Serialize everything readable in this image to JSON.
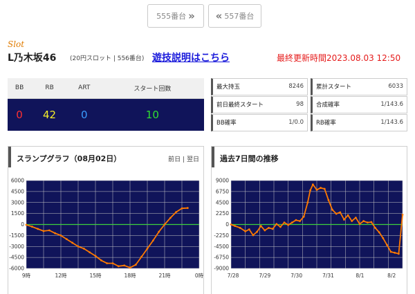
{
  "nav": {
    "prev_label": "555番台",
    "next_label": "557番台",
    "prev_icon": "double-chevron-right-icon",
    "next_icon": "double-chevron-left-icon"
  },
  "header": {
    "category": "Slot",
    "machine_name": "L乃木坂46",
    "machine_info": "(20円スロット | 556番台)",
    "guide_link": "遊技説明はこちら",
    "updated": "最終更新時間2023.08.03 12:50"
  },
  "counts": {
    "headers": [
      "BB",
      "RB",
      "ART",
      "スタート回数"
    ],
    "values": [
      "0",
      "42",
      "0",
      "10"
    ]
  },
  "stats": {
    "left": [
      {
        "label": "最大持玉",
        "value": "8246"
      },
      {
        "label": "前日最終スタート",
        "value": "98"
      },
      {
        "label": "BB確率",
        "value": "1/0.0"
      }
    ],
    "right": [
      {
        "label": "累計スタート",
        "value": "6033"
      },
      {
        "label": "合成確率",
        "value": "1/143.6"
      },
      {
        "label": "RB確率",
        "value": "1/143.6"
      }
    ]
  },
  "slump_panel": {
    "title": "スランプグラフ（08月02日）",
    "prev_link": "前日",
    "separator": "|",
    "next_link": "翌日"
  },
  "week_panel": {
    "title": "過去7日間の推移"
  },
  "colors": {
    "plot_bg": "#10145a",
    "grid": "#c8c8c8",
    "line": "#ff7a00",
    "zero_line": "#3cd23c",
    "accent_orange": "#e07b00",
    "update_red": "#e51b1b",
    "link_blue": "#1a1adb"
  },
  "chart_data": [
    {
      "type": "line",
      "title": "",
      "xlabel": "",
      "ylabel": "",
      "x_ticks": [
        "9時",
        "12時",
        "15時",
        "18時",
        "21時",
        "0時"
      ],
      "ylim": [
        -6000,
        6000
      ],
      "y_ticks": [
        "6000",
        "4500",
        "3000",
        "1500",
        "0",
        "-1500",
        "-3000",
        "-4500",
        "-6000"
      ],
      "x_range": [
        9,
        24
      ],
      "grid": true,
      "zero_line": true,
      "series": [
        {
          "x": [
            9.0,
            9.5,
            10.0,
            10.5,
            11.0,
            11.5,
            12.0,
            12.5,
            13.0,
            13.5,
            14.0,
            14.5,
            15.0,
            15.5,
            16.0,
            16.5,
            17.0,
            17.5,
            18.0,
            18.5,
            19.0,
            19.5,
            20.0,
            20.5,
            21.0,
            21.5,
            22.0,
            22.5,
            23.0
          ],
          "y": [
            -50,
            -300,
            -600,
            -900,
            -800,
            -1200,
            -1500,
            -2000,
            -2500,
            -3000,
            -3300,
            -3800,
            -4300,
            -4900,
            -5300,
            -5300,
            -5700,
            -5600,
            -5900,
            -5500,
            -4400,
            -3300,
            -2200,
            -1000,
            0,
            900,
            1700,
            2200,
            2250
          ]
        }
      ]
    },
    {
      "type": "line",
      "title": "",
      "xlabel": "",
      "ylabel": "",
      "x_ticks": [
        "7/28",
        "7/29",
        "7/30",
        "7/31",
        "8/1",
        "8/2"
      ],
      "ylim": [
        -9000,
        9000
      ],
      "y_ticks": [
        "9000",
        "6750",
        "4500",
        "2250",
        "0",
        "-2250",
        "-4500",
        "-6750",
        "-9000"
      ],
      "x_range": [
        0,
        6.6
      ],
      "grid": true,
      "zero_line": true,
      "series": [
        {
          "x": [
            0.0,
            0.15,
            0.35,
            0.55,
            0.7,
            0.85,
            1.0,
            1.15,
            1.3,
            1.45,
            1.6,
            1.75,
            1.9,
            2.05,
            2.2,
            2.35,
            2.5,
            2.65,
            2.8,
            2.95,
            3.05,
            3.15,
            3.3,
            3.45,
            3.6,
            3.75,
            3.9,
            4.05,
            4.2,
            4.35,
            4.5,
            4.65,
            4.8,
            4.95,
            5.1,
            5.25,
            5.4,
            5.55,
            5.7,
            5.85,
            6.0,
            6.15,
            6.3,
            6.45,
            6.6
          ],
          "y": [
            0,
            -300,
            -700,
            -1400,
            -1000,
            -2200,
            -1500,
            -300,
            -1200,
            -700,
            -900,
            100,
            -500,
            400,
            -100,
            400,
            900,
            700,
            1600,
            4500,
            7000,
            8200,
            7100,
            7500,
            7300,
            5000,
            3000,
            2200,
            2500,
            1000,
            1900,
            700,
            1400,
            100,
            700,
            400,
            500,
            -700,
            -1600,
            -2800,
            -4200,
            -5600,
            -5800,
            -6000,
            2000
          ]
        }
      ]
    }
  ]
}
